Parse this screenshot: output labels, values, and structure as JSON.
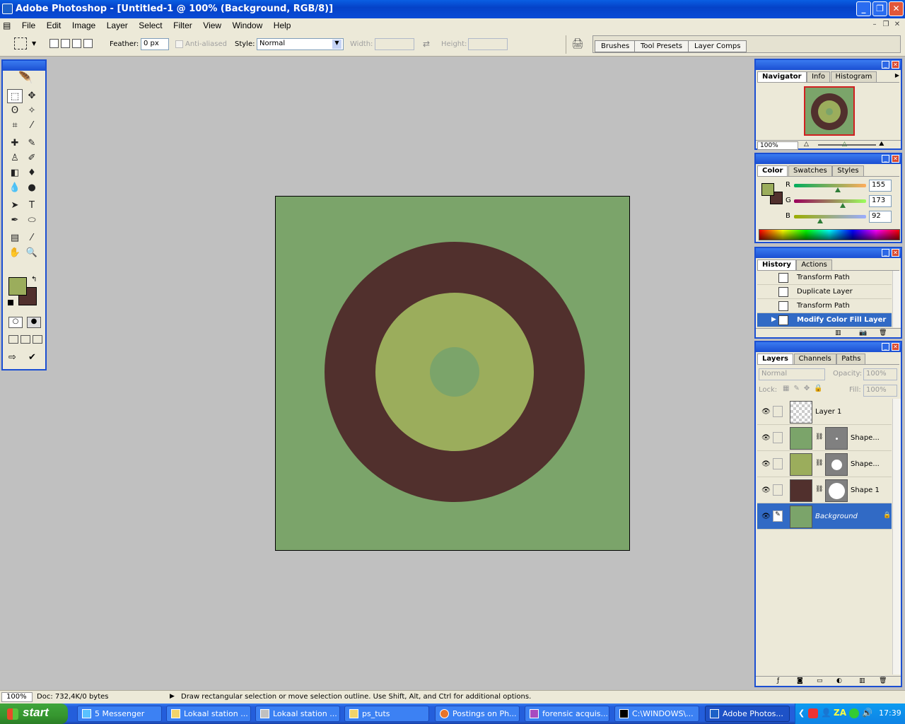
{
  "window": {
    "title": "Adobe Photoshop - [Untitled-1 @ 100% (Background, RGB/8)]"
  },
  "menu": [
    "File",
    "Edit",
    "Image",
    "Layer",
    "Select",
    "Filter",
    "View",
    "Window",
    "Help"
  ],
  "options": {
    "feather_label": "Feather:",
    "feather_value": "0 px",
    "antialiased_label": "Anti-aliased",
    "style_label": "Style:",
    "style_value": "Normal",
    "width_label": "Width:",
    "height_label": "Height:"
  },
  "palette_well": [
    "Brushes",
    "Tool Presets",
    "Layer Comps"
  ],
  "canvas": {
    "bg_color": "#7ba46a",
    "ring_color": "#51302d",
    "inner_color": "#9bad5c",
    "center_color": "#7ba46a"
  },
  "navigator": {
    "tabs": [
      "Navigator",
      "Info",
      "Histogram"
    ],
    "zoom": "100%"
  },
  "color_panel": {
    "tabs": [
      "Color",
      "Swatches",
      "Styles"
    ],
    "r_label": "R",
    "g_label": "G",
    "b_label": "B",
    "r": "155",
    "g": "173",
    "b": "92",
    "r_frac": 0.61,
    "g_frac": 0.68,
    "b_frac": 0.36,
    "fg": "#9bad5c",
    "bg": "#51302d"
  },
  "history": {
    "tabs": [
      "History",
      "Actions"
    ],
    "items": [
      "Transform Path",
      "Duplicate Layer",
      "Transform Path",
      "Modify Color Fill Layer"
    ]
  },
  "layers": {
    "tabs": [
      "Layers",
      "Channels",
      "Paths"
    ],
    "blend": "Normal",
    "opacity_label": "Opacity:",
    "opacity": "100%",
    "lock_label": "Lock:",
    "fill_label": "Fill:",
    "fill": "100%",
    "items": [
      {
        "name": "Layer 1"
      },
      {
        "name": "Shape..."
      },
      {
        "name": "Shape..."
      },
      {
        "name": "Shape 1"
      },
      {
        "name": "Background"
      }
    ]
  },
  "status": {
    "zoom": "100%",
    "doc": "Doc: 732,4K/0 bytes",
    "hint": "Draw rectangular selection or move selection outline.  Use Shift, Alt, and Ctrl for additional options."
  },
  "taskbar": {
    "start": "start",
    "buttons": [
      "5 Messenger",
      "Lokaal station ...",
      "Lokaal station ...",
      "ps_tuts",
      "Postings on Ph...",
      "forensic acquis...",
      "C:\\WINDOWS\\...",
      "Adobe Photos..."
    ],
    "clock": "17:39",
    "tray_text": "ZA"
  }
}
